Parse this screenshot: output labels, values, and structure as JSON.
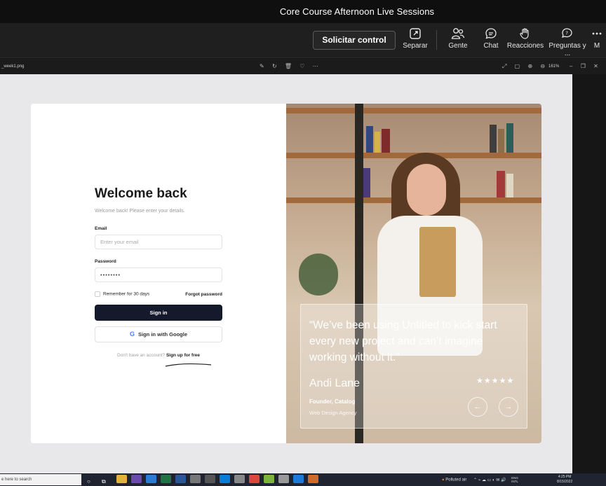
{
  "window": {
    "title": "Core Course Afternoon Live Sessions"
  },
  "toolbar": {
    "request_control": "Solicitar control",
    "items": [
      {
        "label": "Separar",
        "icon": "pop-out-icon"
      },
      {
        "label": "Gente",
        "icon": "people-icon"
      },
      {
        "label": "Chat",
        "icon": "chat-icon"
      },
      {
        "label": "Reacciones",
        "icon": "raise-hand-icon"
      },
      {
        "label": "Preguntas y ...",
        "icon": "qa-icon"
      },
      {
        "label": "M",
        "icon": "more-icon"
      }
    ]
  },
  "viewer": {
    "filename": "_week1.png",
    "zoom": "161%"
  },
  "login": {
    "title": "Welcome back",
    "subtitle": "Welcome back! Please enter your details.",
    "email_label": "Email",
    "email_placeholder": "Enter your email",
    "password_label": "Password",
    "password_value": "••••••••",
    "remember": "Remember for 30 days",
    "forgot": "Forgot password",
    "signin": "Sign in",
    "google": "Sign in with Google",
    "no_account": "Don't have an account?",
    "signup": "Sign up for free"
  },
  "testimonial": {
    "quote": "“We’ve been using Untitled to kick start every new project and can’t imagine working without it.”",
    "author": "Andi Lane",
    "role": "Founder, Catalog",
    "company": "Web Design Agency",
    "rating": 5,
    "stars": "★★★★★"
  },
  "taskbar": {
    "search_placeholder": "e here to search",
    "weather": "Polluted air",
    "lang": "ENG",
    "region": "INTL",
    "time": "4:25 PM",
    "date": "8/15/2022"
  },
  "colors": {
    "signin_button": "#141a2b",
    "teams_toolbar": "#1f1f1f",
    "canvas": "#e8e8ea"
  }
}
